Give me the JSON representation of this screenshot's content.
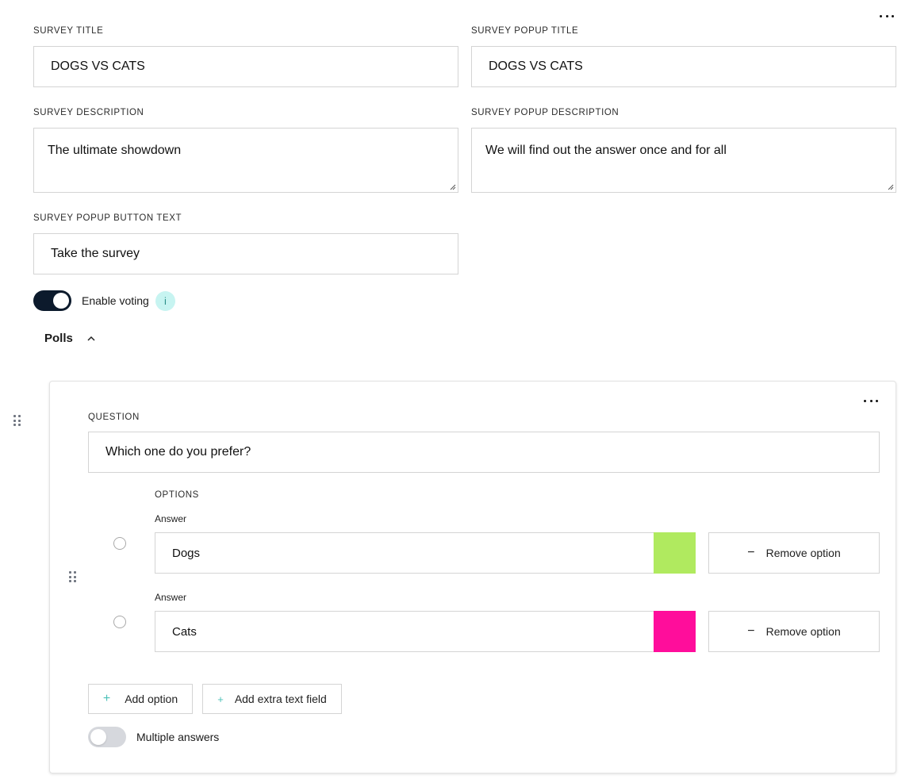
{
  "form": {
    "survey_title_label": "SURVEY TITLE",
    "survey_title_value": "DOGS VS CATS",
    "popup_title_label": "SURVEY POPUP TITLE",
    "popup_title_value": "DOGS VS CATS",
    "survey_description_label": "SURVEY DESCRIPTION",
    "survey_description_value": "The ultimate showdown",
    "popup_description_label": "SURVEY POPUP DESCRIPTION",
    "popup_description_value": "We will find out the answer once and for all",
    "popup_button_text_label": "SURVEY POPUP BUTTON TEXT",
    "popup_button_text_value": "Take the survey"
  },
  "voting": {
    "label": "Enable voting",
    "enabled": true,
    "info_icon": "info-icon",
    "info_glyph": "i"
  },
  "polls": {
    "heading": "Polls",
    "expanded": true,
    "question_label": "QUESTION",
    "question_value": "Which one do you prefer?",
    "options_label": "OPTIONS",
    "answers": [
      {
        "label": "Answer",
        "value": "Dogs",
        "color": "#b0ea5f",
        "remove_label": "Remove option"
      },
      {
        "label": "Answer",
        "value": "Cats",
        "color": "#ff0d9b",
        "remove_label": "Remove option"
      }
    ],
    "add_option_label": "Add option",
    "add_text_field_label": "Add extra text field",
    "multiple_answers_label": "Multiple answers",
    "multiple_answers_enabled": false
  },
  "colors": {
    "toggle_on": "#0c1a2c",
    "toggle_off": "#d6d8dd",
    "info_bg": "#c7f4f1",
    "info_fg": "#2c8f89",
    "plus_accent": "#4cc1b8"
  }
}
